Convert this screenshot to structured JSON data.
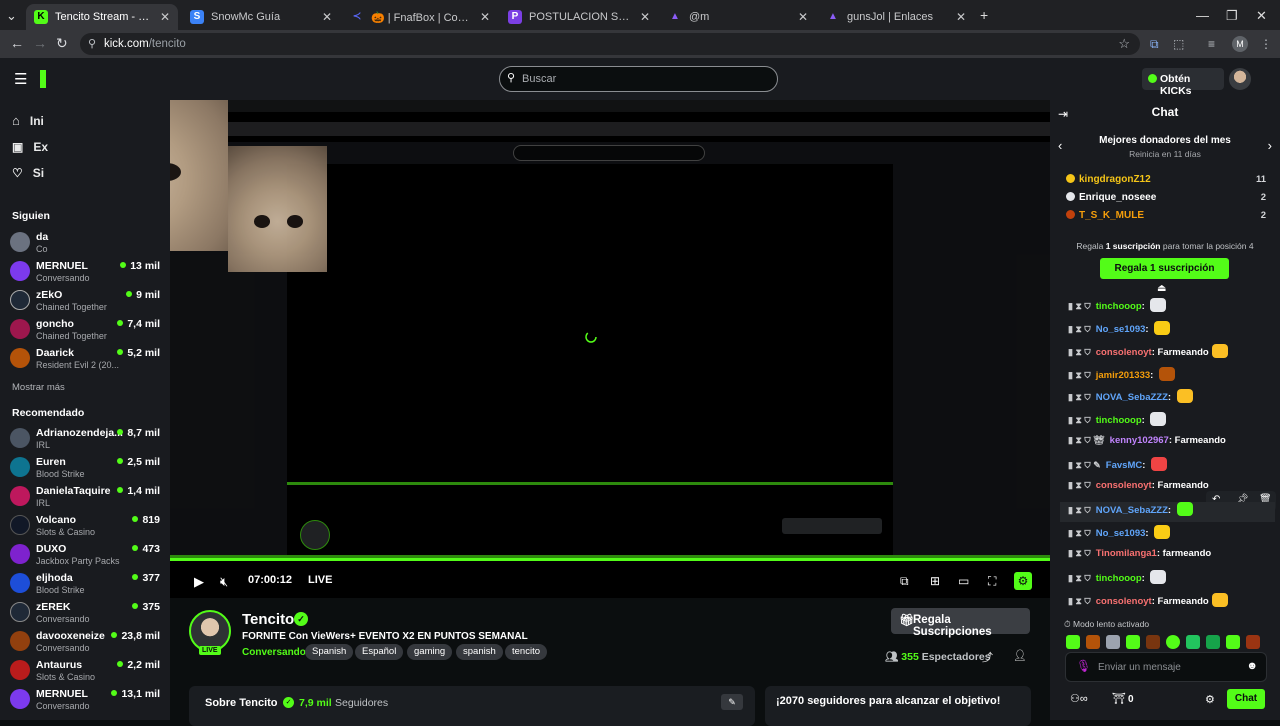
{
  "browser": {
    "tabs": [
      {
        "label": "Tencito Stream - Watch Live on Kick",
        "favicon": "K",
        "color": "#53fc18",
        "active": true
      },
      {
        "label": "SnowMc Guía",
        "favicon": "S",
        "color": "#3b82f6",
        "active": false
      },
      {
        "label": "🎃 | FnafBox | Console",
        "favicon": "≺",
        "color": "#5865f2",
        "active": false
      },
      {
        "label": "POSTULACION STAFF | SnowMc",
        "favicon": "P",
        "color": "#7b3fe4",
        "active": false
      },
      {
        "label": "@m",
        "favicon": "▲",
        "color": "#8b5cf6",
        "active": false
      },
      {
        "label": "gunsJol | Enlaces",
        "favicon": "▲",
        "color": "#8b5cf6",
        "active": false
      }
    ],
    "new_tab": "+",
    "url_domain": "kick.com",
    "url_path": "/tencito",
    "profile_initial": "M"
  },
  "site": {
    "search_placeholder": "Buscar",
    "kicks_label": "Obtén KICKs"
  },
  "sidebar": {
    "nav": [
      "Ini",
      "Ex",
      "Si"
    ],
    "following_header": "Siguien",
    "following": [
      {
        "name": "da",
        "category": "Co",
        "viewers": "",
        "color": "#6b7280"
      },
      {
        "name": "MERNUEL",
        "category": "Conversando",
        "viewers": "13 mil",
        "color": "#7c3aed"
      },
      {
        "name": "zEkO",
        "category": "Chained Together",
        "viewers": "9 mil",
        "color": "#1f2937"
      },
      {
        "name": "goncho",
        "category": "Chained Together",
        "viewers": "7,4 mil",
        "color": "#9d174d"
      },
      {
        "name": "Daarick",
        "category": "Resident Evil 2 (20...",
        "viewers": "5,2 mil",
        "color": "#b45309"
      }
    ],
    "show_more": "Mostrar más",
    "recommended_header": "Recomendado",
    "recommended": [
      {
        "name": "Adrianozendeja...",
        "category": "IRL",
        "viewers": "8,7 mil",
        "color": "#4b5563"
      },
      {
        "name": "Euren",
        "category": "Blood Strike",
        "viewers": "2,5 mil",
        "color": "#0e7490"
      },
      {
        "name": "DanielaTaquire",
        "category": "IRL",
        "viewers": "1,4 mil",
        "color": "#be185d"
      },
      {
        "name": "Volcano",
        "category": "Slots & Casino",
        "viewers": "819",
        "color": "#111827"
      },
      {
        "name": "DUXO",
        "category": "Jackbox Party Packs",
        "viewers": "473",
        "color": "#7e22ce"
      },
      {
        "name": "eljhoda",
        "category": "Blood Strike",
        "viewers": "377",
        "color": "#1d4ed8"
      },
      {
        "name": "zEREK",
        "category": "Conversando",
        "viewers": "375",
        "color": "#1f2937"
      },
      {
        "name": "davooxeneize",
        "category": "Conversando",
        "viewers": "23,8 mil",
        "color": "#92400e"
      },
      {
        "name": "Antaurus",
        "category": "Slots & Casino",
        "viewers": "2,2 mil",
        "color": "#b91c1c"
      },
      {
        "name": "MERNUEL",
        "category": "Conversando",
        "viewers": "13,1 mil",
        "color": "#7c3aed"
      }
    ]
  },
  "player": {
    "time": "07:00:12",
    "live_label": "LIVE"
  },
  "stream": {
    "name": "Tencito",
    "live_badge": "LIVE",
    "title": "FORNITE Con VieWers+ EVENTO X2 EN PUNTOS SEMANAL",
    "category": "Conversando",
    "tags": [
      "Spanish",
      "Español",
      "gaming",
      "spanish",
      "tencito"
    ],
    "subs_button": "Regala Suscripciones",
    "viewers_count": "355",
    "viewers_label": "Espectadores",
    "about_label": "Sobre Tencito",
    "followers_count": "7,9 mil",
    "followers_label": "Seguidores",
    "goal_text": "¡2070 seguidores para alcanzar el objetivo!"
  },
  "chat": {
    "header": "Chat",
    "donors_title": "Mejores donadores del mes",
    "donors_subtitle": "Reinicia en 11 días",
    "donors": [
      {
        "name": "kingdragonZ12",
        "count": "11",
        "color": "#f5c518"
      },
      {
        "name": "Enrique_noseee",
        "count": "2",
        "color": "#e5e7eb"
      },
      {
        "name": "T_S_K_MULE",
        "count": "2",
        "color": "#f59e0b"
      }
    ],
    "gift_prefix": "Regala",
    "gift_bold": "1 suscripción",
    "gift_suffix": "para tomar la posición 4",
    "gift_button": "Regala 1 suscripción",
    "messages": [
      {
        "user": "tinchooop",
        "text": "",
        "color": "#53fc18",
        "emote": "#e5e7eb"
      },
      {
        "user": "No_se1093",
        "text": "",
        "color": "#60a5fa",
        "emote": "#facc15"
      },
      {
        "user": "consolenoyt",
        "text": "Farmeando",
        "color": "#f87171",
        "emote": "#fbbf24"
      },
      {
        "user": "jamir201333",
        "text": "",
        "color": "#f59e0b",
        "emote": "#b45309"
      },
      {
        "user": "NOVA_SebaZZZ",
        "text": "",
        "color": "#60a5fa",
        "emote": "#fbbf24"
      },
      {
        "user": "tinchooop",
        "text": "",
        "color": "#53fc18",
        "emote": "#e5e7eb"
      },
      {
        "user": "kenny102967",
        "text": "Farmeando",
        "color": "#c084fc",
        "emote": ""
      },
      {
        "user": "FavsMC",
        "text": "",
        "color": "#60a5fa",
        "emote": "#ef4444"
      },
      {
        "user": "consolenoyt",
        "text": "Farmeando",
        "color": "#f87171",
        "emote": "#fbbf24"
      },
      {
        "user": "NOVA_SebaZZZ",
        "text": "",
        "color": "#60a5fa",
        "emote": "#53fc18"
      },
      {
        "user": "No_se1093",
        "text": "",
        "color": "#60a5fa",
        "emote": "#facc15"
      },
      {
        "user": "Tinomilanga1",
        "text": "farmeando",
        "color": "#f87171",
        "emote": ""
      },
      {
        "user": "tinchooop",
        "text": "",
        "color": "#53fc18",
        "emote": "#e5e7eb"
      },
      {
        "user": "consolenoyt",
        "text": "Farmeando",
        "color": "#f87171",
        "emote": "#fbbf24"
      }
    ],
    "slow_mode": "Modo lento activado",
    "input_placeholder": "Enviar un mensaje",
    "points": "0",
    "send_button": "Chat"
  },
  "colors": {
    "accent": "#53fc18",
    "background": "#0b0e0f",
    "panel": "#191b1f"
  }
}
